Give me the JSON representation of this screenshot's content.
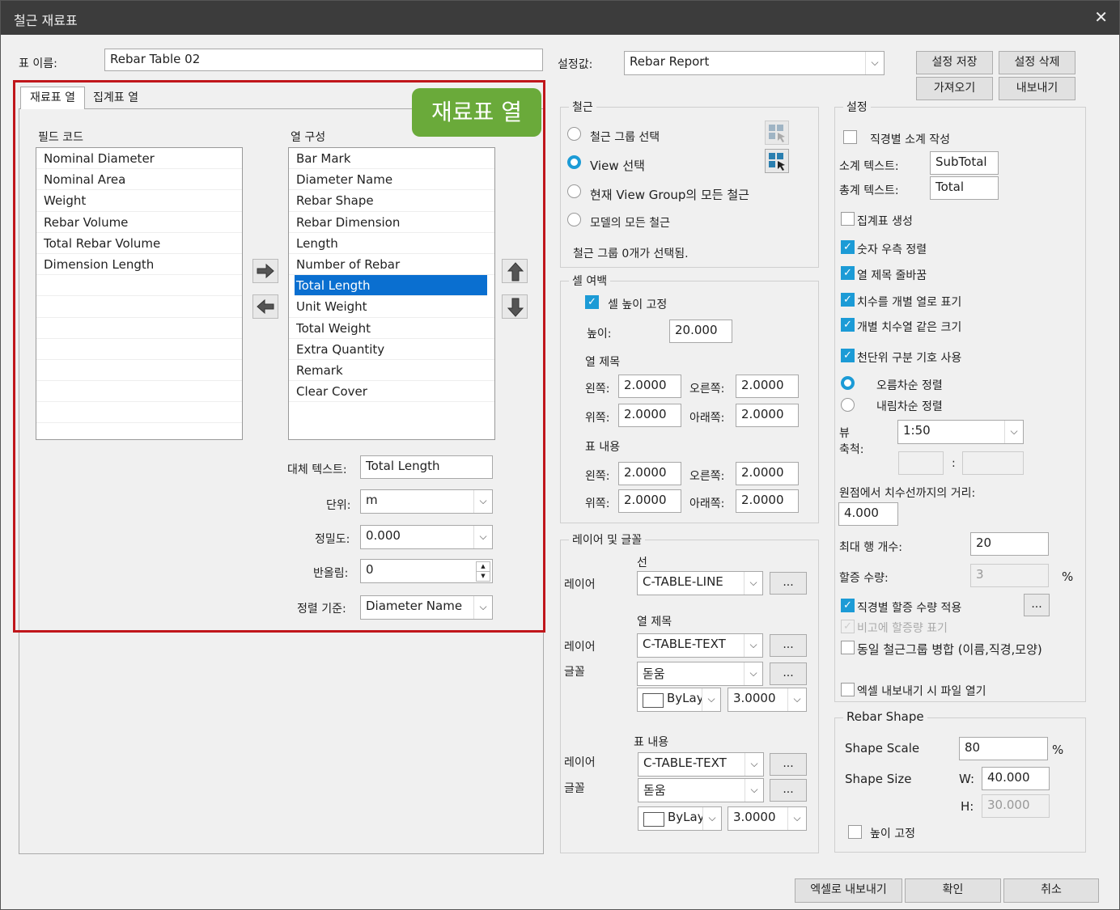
{
  "window": {
    "title": "철근 재료표",
    "close": "✕"
  },
  "table_name": {
    "label": "표 이름:",
    "value": "Rebar Table 02"
  },
  "preset": {
    "label": "설정값:",
    "value": "Rebar Report",
    "save": "설정 저장",
    "delete": "설정 삭제",
    "import": "가져오기",
    "export": "내보내기"
  },
  "tabs": [
    "재료표 열",
    "집계표 열"
  ],
  "badge": "재료표 열",
  "field_code": {
    "label": "필드 코드",
    "items": [
      "Nominal Diameter",
      "Nominal Area",
      "Weight",
      "Rebar Volume",
      "Total Rebar Volume",
      "Dimension Length"
    ]
  },
  "columns": {
    "label": "열 구성",
    "items": [
      "Bar Mark",
      "Diameter Name",
      "Rebar Shape",
      "Rebar Dimension",
      "Length",
      "Number of Rebar",
      "Total Length",
      "Unit Weight",
      "Total Weight",
      "Extra Quantity",
      "Remark",
      "Clear Cover"
    ],
    "selected": "Total Length"
  },
  "column_props": {
    "alt_text_label": "대체 텍스트:",
    "alt_text": "Total Length",
    "unit_label": "단위:",
    "unit": "m",
    "precision_label": "정밀도:",
    "precision": "0.000",
    "rounding_label": "반올림:",
    "rounding": "0",
    "sort_label": "정렬 기준:",
    "sort": "Diameter Name"
  },
  "rebar_group": {
    "title": "철근",
    "opt1": "철근 그룹 선택",
    "opt2": "View 선택",
    "opt3": "현재 View Group의 모든 철근",
    "opt4": "모델의 모든 철근",
    "status": "철근 그룹 0개가 선택됨."
  },
  "cell_margin": {
    "title": "셀 여백",
    "fix_height": "셀 높이 고정",
    "height_label": "높이:",
    "height": "20.000",
    "col_title": "열 제목",
    "content": "표 내용",
    "left": "왼쪽:",
    "right": "오른쪽:",
    "top": "위쪽:",
    "bottom": "아래쪽:",
    "v": "2.0000"
  },
  "layer_font": {
    "title": "레이어 및 글꼴",
    "line": "선",
    "layer": "레이어",
    "font": "글꼴",
    "col_title": "열 제목",
    "content": "표 내용",
    "line_layer": "C-TABLE-LINE",
    "text_layer": "C-TABLE-TEXT",
    "font_name": "돋움",
    "color": "ByLayer",
    "size": "3.0000",
    "dots": "..."
  },
  "settings": {
    "title": "설정",
    "subtotal_by_dia": "직경별 소계 작성",
    "subtotal_label": "소계 텍스트:",
    "subtotal": "SubTotal",
    "total_label": "총계 텍스트:",
    "total": "Total",
    "make_summary": "집계표 생성",
    "right_align": "숫자 우측 정렬",
    "wrap": "열 제목 줄바꿈",
    "dim_cols": "치수를 개별 열로 표기",
    "same_size": "개별 치수열 같은 크기",
    "thousands": "천단위 구분 기호 사용",
    "asc": "오름차순 정렬",
    "desc": "내림차순 정렬",
    "view_scale_label": "뷰\n축척:",
    "view_scale": "1:50",
    "colon": ":",
    "origin_dist_label": "원점에서 치수선까지의 거리:",
    "origin_dist": "4.000",
    "max_rows_label": "최대 행 개수:",
    "max_rows": "20",
    "extra_label": "할증 수량:",
    "extra": "3",
    "pct": "%",
    "extra_by_dia": "직경별 할증 수량 적용",
    "note_extra": "비고에 할증량 표기",
    "merge_group": "동일 철근그룹 병합 (이름,직경,모양)",
    "open_excel": "엑셀 내보내기 시 파일 열기"
  },
  "rebar_shape": {
    "title": "Rebar Shape",
    "scale_label": "Shape Scale",
    "scale": "80",
    "pct": "%",
    "size_label": "Shape Size",
    "w_label": "W:",
    "w": "40.000",
    "h_label": "H:",
    "h": "30.000",
    "fix_height": "높이 고정"
  },
  "footer": {
    "excel": "엑셀로 내보내기",
    "ok": "확인",
    "cancel": "취소"
  },
  "colors": {
    "accent": "#1c9bd6",
    "selection": "#0a6fd0",
    "highlight_border": "#c0161b",
    "badge": "#6aaa3a"
  }
}
